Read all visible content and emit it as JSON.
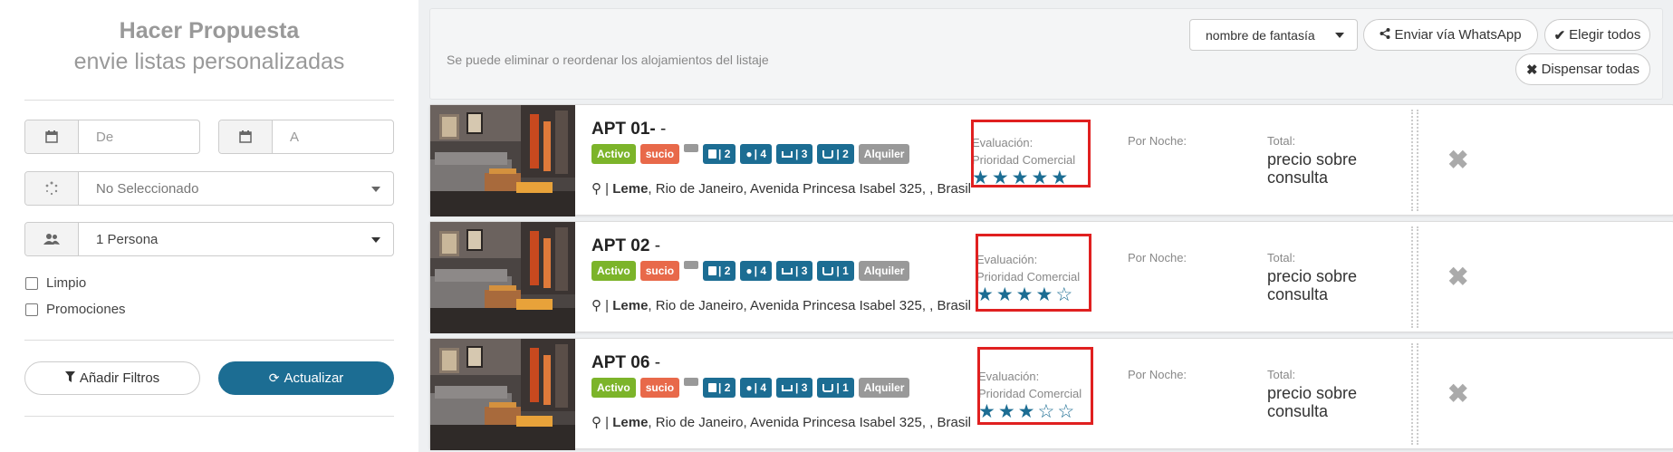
{
  "left": {
    "title": "Hacer Propuesta",
    "subtitle": "envie listas personalizadas",
    "date_from_placeholder": "De",
    "date_to_placeholder": "A",
    "status_select": "No Seleccionado",
    "people_select": "1 Persona",
    "checkboxes": [
      "Limpio",
      "Promociones"
    ],
    "add_filters_label": "Añadir Filtros",
    "update_label": "Actualizar"
  },
  "toolbar": {
    "hint": "Se puede eliminar o reordenar los alojamientos del listaje",
    "sort_select": "nombre de fantasía",
    "whatsapp_label": "Enviar vía WhatsApp",
    "choose_all_label": "Elegir todos",
    "dismiss_all_label": "Dispensar todas"
  },
  "labels": {
    "evaluacion": "Evaluación:",
    "prioridad": "Prioridad Comercial",
    "por_noche": "Por Noche:",
    "total": "Total:",
    "price": "precio sobre consulta"
  },
  "listings": [
    {
      "name": "APT 01-",
      "suffix": "-",
      "badges": {
        "status": "Activo",
        "clean": "sucio",
        "bedrooms": "| 2",
        "guests": "| 4",
        "beds": "| 3",
        "baths": "| 2",
        "type": "Alquiler"
      },
      "neighborhood": "Leme",
      "address": ", Rio de Janeiro, Avenida Princesa Isabel 325, , Brasil",
      "rating": 5
    },
    {
      "name": "APT 02",
      "suffix": "-",
      "badges": {
        "status": "Activo",
        "clean": "sucio",
        "bedrooms": "| 2",
        "guests": "| 4",
        "beds": "| 3",
        "baths": "| 1",
        "type": "Alquiler"
      },
      "neighborhood": "Leme",
      "address": ", Rio de Janeiro, Avenida Princesa Isabel 325, , Brasil",
      "rating": 4
    },
    {
      "name": "APT 06",
      "suffix": "-",
      "badges": {
        "status": "Activo",
        "clean": "sucio",
        "bedrooms": "| 2",
        "guests": "| 4",
        "beds": "| 3",
        "baths": "| 1",
        "type": "Alquiler"
      },
      "neighborhood": "Leme",
      "address": ", Rio de Janeiro, Avenida Princesa Isabel 325, , Brasil",
      "rating": 3
    }
  ],
  "colors": {
    "primary": "#1c6d93",
    "activo": "#7cb42a",
    "sucio": "#e8694a",
    "highlight": "#e02020"
  }
}
